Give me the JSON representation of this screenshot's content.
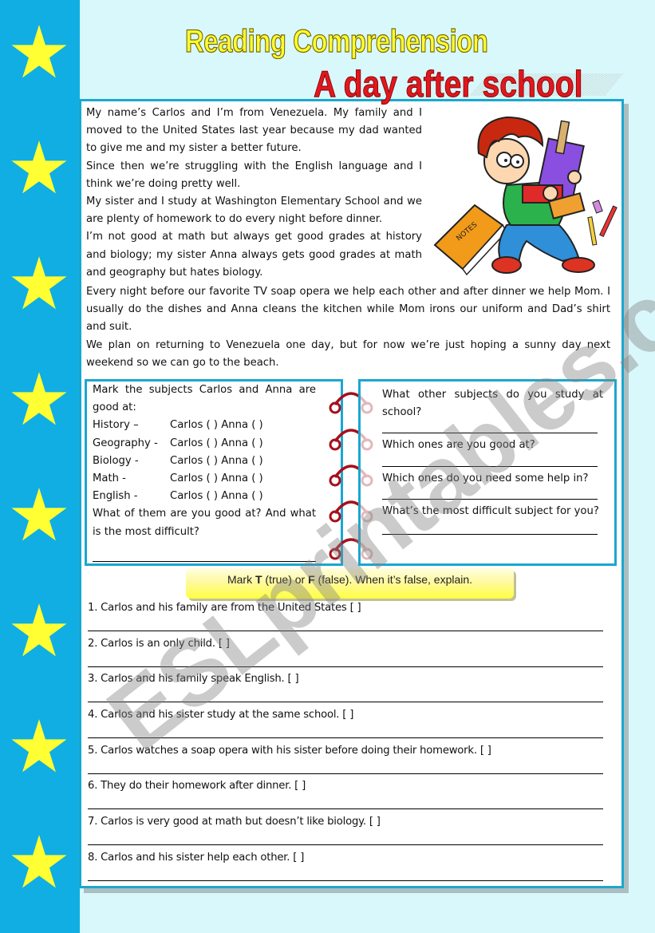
{
  "header": {
    "title": "Reading Comprehension",
    "subtitle": "A day after school"
  },
  "colors": {
    "sidebar": "#10aee3",
    "star": "#ffff33",
    "border": "#1aa7cf",
    "page_bg": "#d9f8fb",
    "title_yellow": "#ffff33",
    "subtitle_red": "#e0181f",
    "ring_red": "#a5101c"
  },
  "sidebar": {
    "stars": [
      "star-icon",
      "star-icon",
      "star-icon",
      "star-icon",
      "star-icon",
      "star-icon",
      "star-icon",
      "star-icon"
    ]
  },
  "story": {
    "paragraphs_top": [
      "My name’s Carlos and I’m from Venezuela. My family and I moved to the United States last year because my dad wanted to give me and my sister a better future.",
      "Since then we’re struggling with the English language and I think we’re doing pretty well.",
      "My sister and I study at Washington Elementary School and we are plenty of homework to do every night before dinner.",
      "I’m not good at math but always get good grades at history and biology; my sister Anna always gets good grades at math and geography but hates biology."
    ],
    "paragraphs_wide": [
      "Every night before our favorite TV soap opera we help each other and after dinner we help Mom. I usually do the dishes and  Anna cleans the kitchen while Mom irons our uniform and Dad’s shirt and suit.",
      "We plan on returning to Venezuela one day, but for now we’re just hoping a sunny day next weekend so we can go to the beach."
    ],
    "illustration": "boy-carrying-books-illustration"
  },
  "subjects_exercise": {
    "intro": "Mark the subjects Carlos and Anna are good at:",
    "rows": [
      {
        "subject": "History –",
        "carlos": "Carlos (   )",
        "anna": "Anna (   )"
      },
      {
        "subject": "Geography -",
        "carlos": "Carlos (   )",
        "anna": "Anna (   )"
      },
      {
        "subject": "Biology -",
        "carlos": "Carlos (   )",
        "anna": "Anna (   )"
      },
      {
        "subject": "Math -",
        "carlos": "Carlos (   )",
        "anna": "Anna (   )"
      },
      {
        "subject": "English -",
        "carlos": "Carlos (   )",
        "anna": "Anna (   )"
      }
    ],
    "question": "What of them are you good at? And what is the most difficult?"
  },
  "personal_questions": [
    "What other subjects do you study at school?",
    "Which ones are you good at?",
    "Which ones do you need some help in?",
    "What’s the most difficult subject for you?"
  ],
  "true_false": {
    "instruction_pre": "Mark ",
    "instruction_t": "T",
    "instruction_mid": " (true) or ",
    "instruction_f": "F",
    "instruction_post": " (false). When it’s false, explain.",
    "items": [
      "1. Carlos and his family are from the United States [ ]",
      "2. Carlos is an only child. [   ]",
      "3. Carlos and his family speak English. [   ]",
      "4. Carlos and his sister study at the same school. [   ]",
      "5. Carlos watches a soap opera with his sister before doing their homework. [   ]",
      "6. They do their homework after dinner. [   ]",
      "7. Carlos is very good at math but doesn’t like biology. [   ]",
      "8. Carlos and his sister help each other. [   ]"
    ]
  },
  "watermark": "ESLprintables.com"
}
